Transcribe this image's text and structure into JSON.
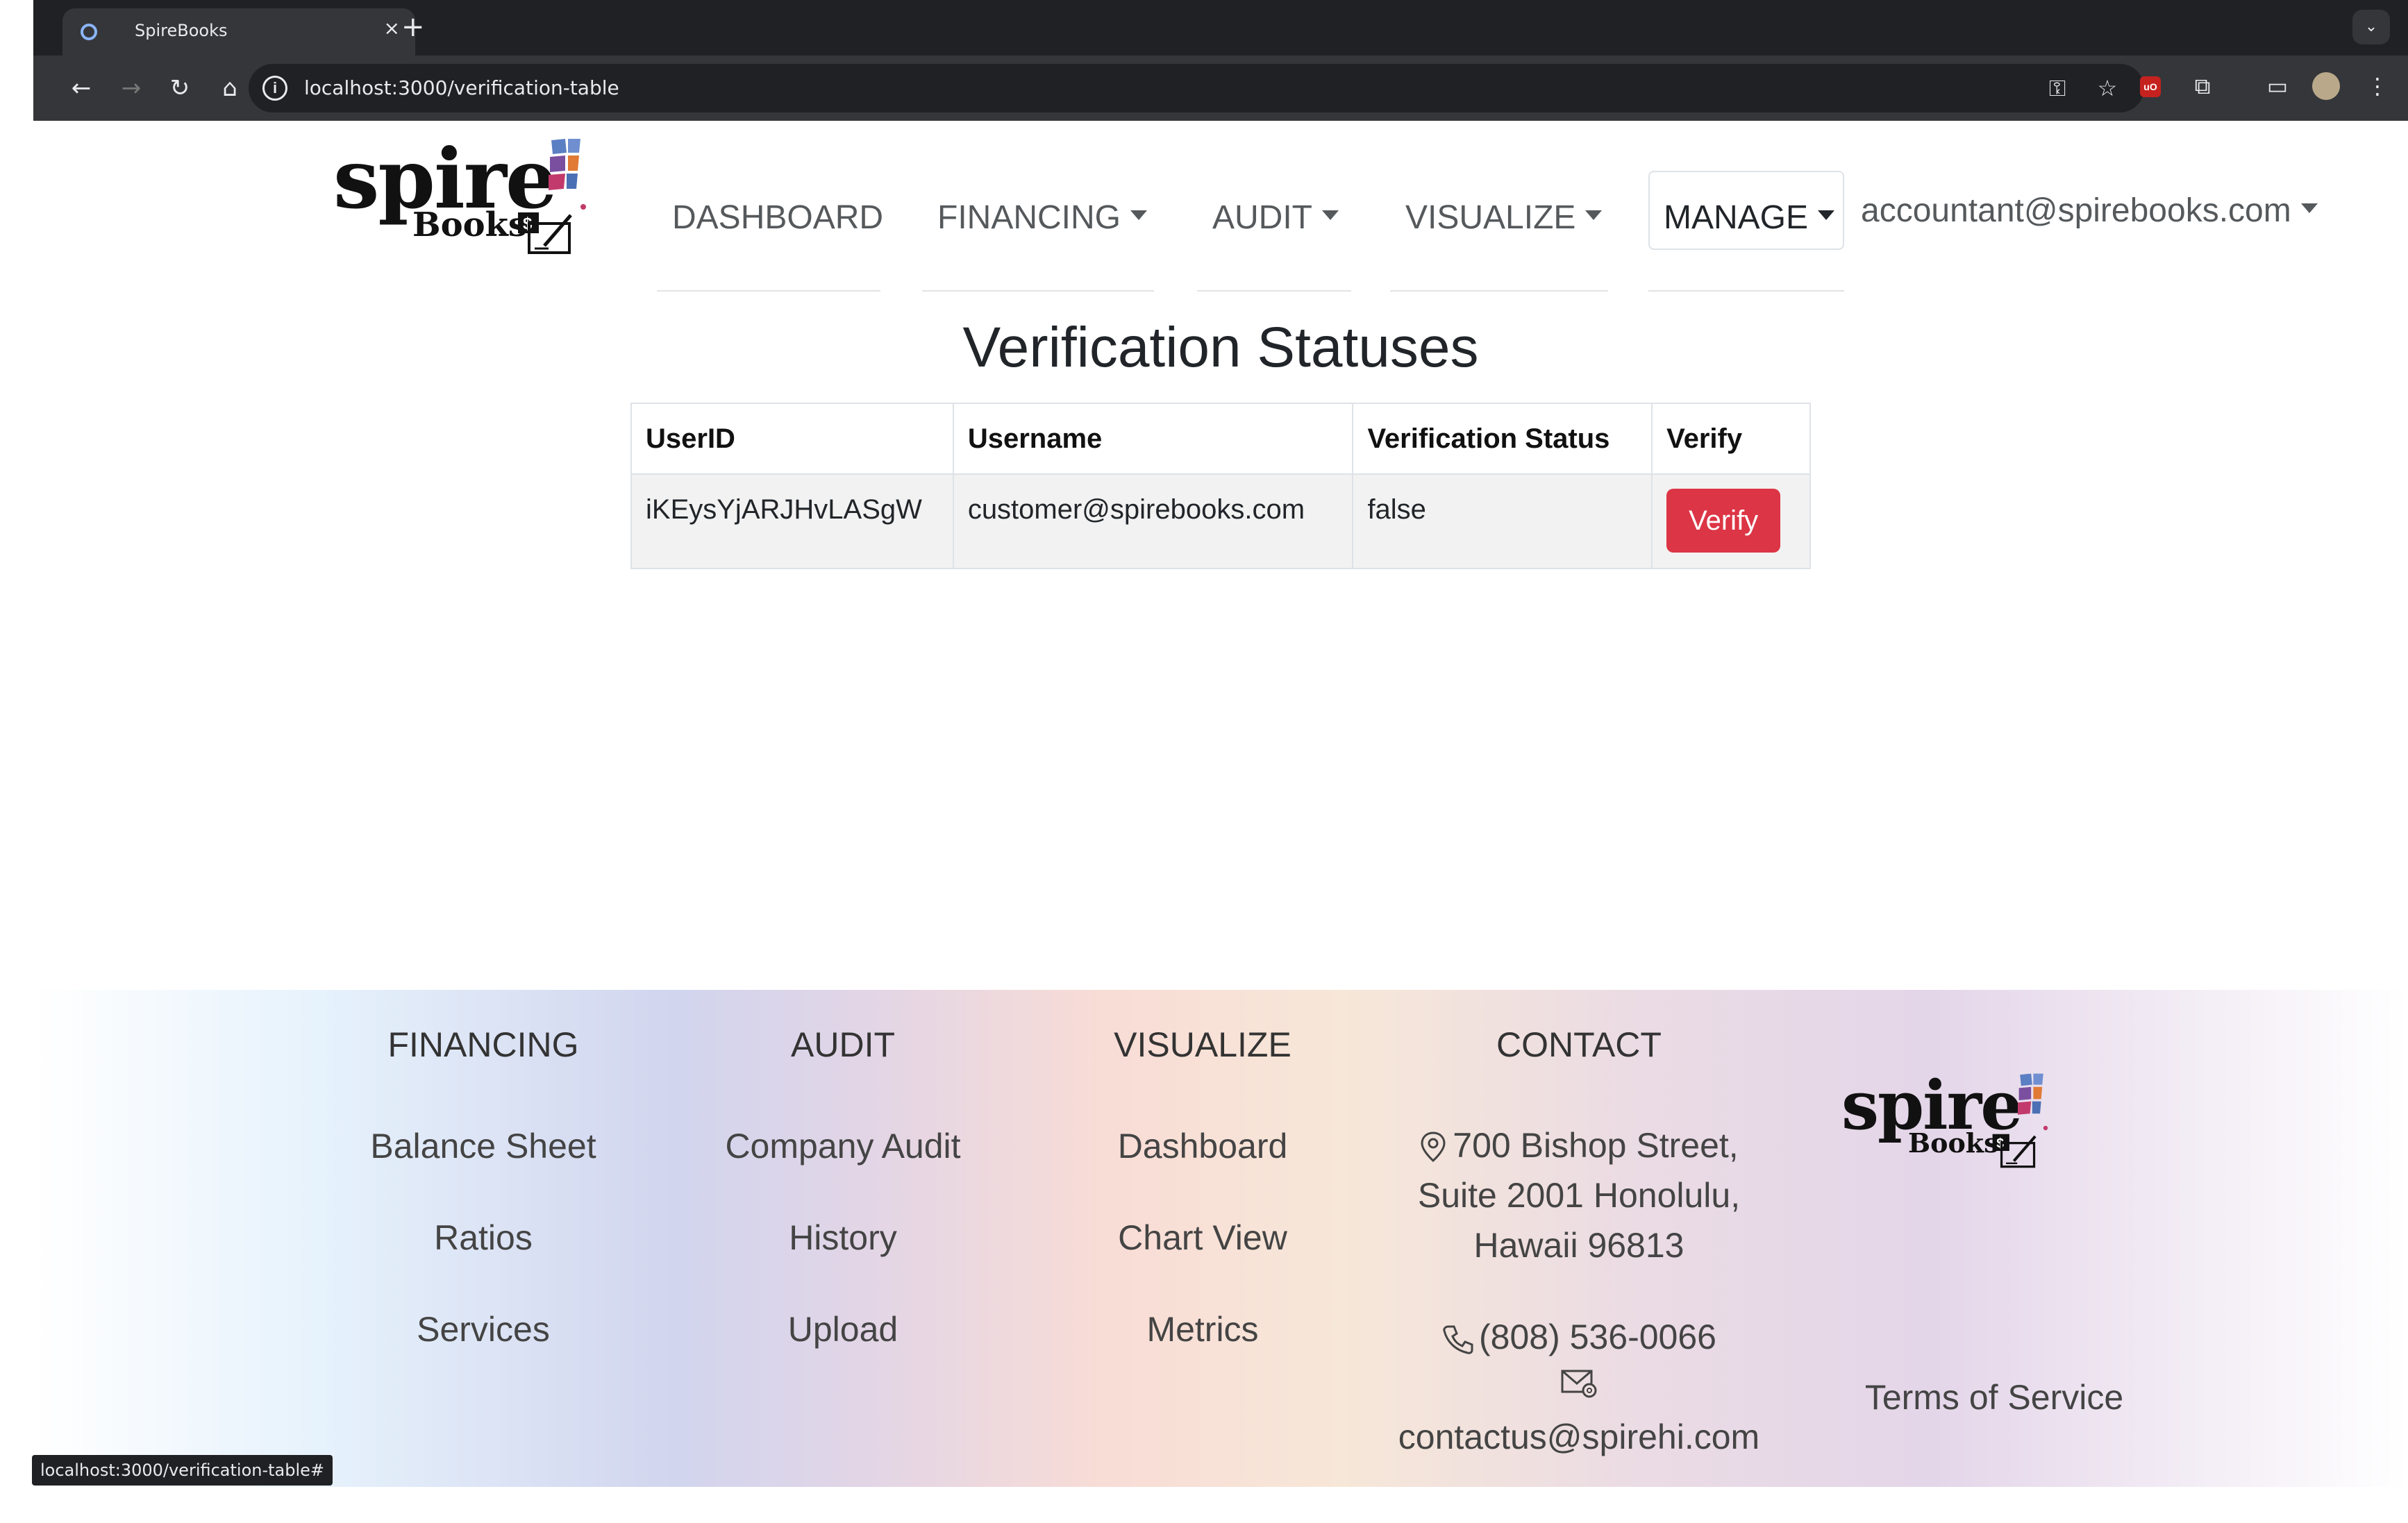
{
  "browser": {
    "tab_title": "SpireBooks",
    "tab_close": "×",
    "new_tab": "+",
    "tab_menu": "⌄",
    "url": "localhost:3000/verification-table",
    "status_url": "localhost:3000/verification-table#"
  },
  "logo": {
    "word1": "spire",
    "word2": "Books",
    "tile_colors": [
      "#5b7fc3",
      "#c23a6b",
      "#e07a35",
      "#7b4fa0",
      "#4b6fb5"
    ]
  },
  "nav": {
    "dashboard": "DASHBOARD",
    "financing": "FINANCING",
    "audit": "AUDIT",
    "visualize": "VISUALIZE",
    "manage": "MANAGE",
    "user": "accountant@spirebooks.com"
  },
  "page": {
    "title": "Verification Statuses"
  },
  "table": {
    "headers": [
      "UserID",
      "Username",
      "Verification Status",
      "Verify"
    ],
    "rows": [
      {
        "user_id": "iKEysYjARJHvLASgW",
        "username": "customer@spirebooks.com",
        "status": "false",
        "action": "Verify"
      }
    ]
  },
  "footer": {
    "financing": {
      "heading": "FINANCING",
      "links": [
        "Balance Sheet",
        "Ratios",
        "Services"
      ]
    },
    "audit": {
      "heading": "AUDIT",
      "links": [
        "Company Audit",
        "History",
        "Upload"
      ]
    },
    "visualize": {
      "heading": "VISUALIZE",
      "links": [
        "Dashboard",
        "Chart View",
        "Metrics"
      ]
    },
    "contact": {
      "heading": "CONTACT",
      "address_line1": "700 Bishop Street,",
      "address_line2": "Suite 2001 Honolulu,",
      "address_line3": "Hawaii 96813",
      "phone": "(808) 536-0066",
      "email": "contactus@spirehi.com"
    },
    "terms": "Terms of Service"
  },
  "colors": {
    "verify_button": "#dc3545",
    "browser_dark": "#202124"
  }
}
